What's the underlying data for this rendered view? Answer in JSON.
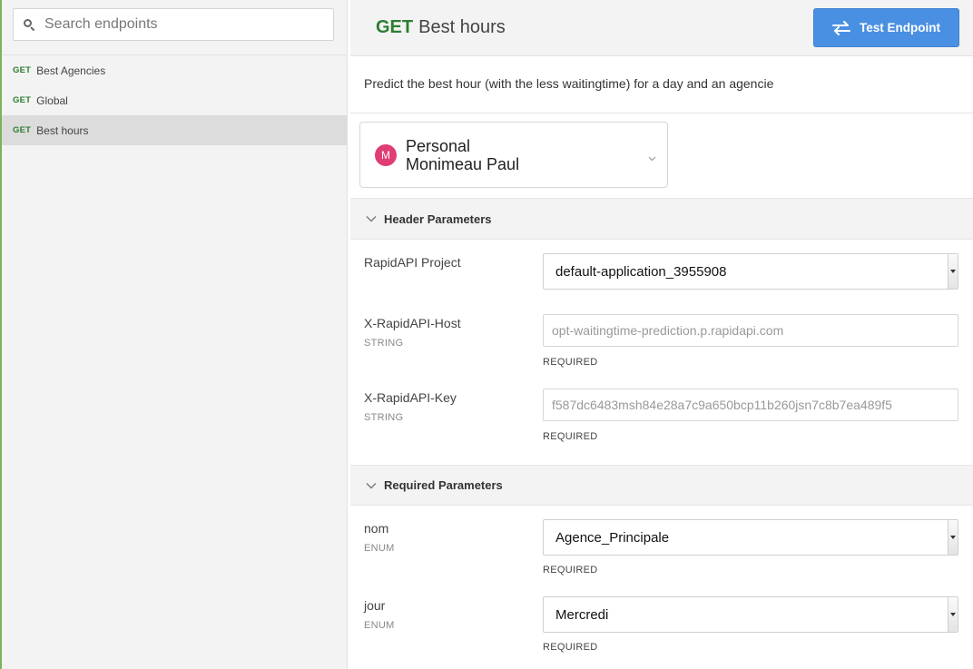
{
  "sidebar": {
    "search_placeholder": "Search endpoints",
    "endpoints": [
      {
        "method": "GET",
        "label": "Best Agencies"
      },
      {
        "method": "GET",
        "label": "Global"
      },
      {
        "method": "GET",
        "label": "Best hours"
      }
    ]
  },
  "header": {
    "method": "GET",
    "title": "Best hours",
    "test_button": "Test Endpoint"
  },
  "description": "Predict the best hour (with the less waitingtime) for a day and an agencie",
  "account": {
    "avatar_letter": "M",
    "line1": "Personal",
    "line2": "Monimeau Paul"
  },
  "header_params": {
    "title": "Header Parameters",
    "project_label": "RapidAPI Project",
    "project_value": "default-application_3955908",
    "host_label": "X-RapidAPI-Host",
    "host_type": "STRING",
    "host_value": "opt-waitingtime-prediction.p.rapidapi.com",
    "host_required": "REQUIRED",
    "key_label": "X-RapidAPI-Key",
    "key_type": "STRING",
    "key_value": "f587dc6483msh84e28a7c9a650bcp11b260jsn7c8b7ea489f5",
    "key_required": "REQUIRED"
  },
  "required_params": {
    "title": "Required Parameters",
    "nom_label": "nom",
    "nom_type": "ENUM",
    "nom_value": "Agence_Principale",
    "nom_required": "REQUIRED",
    "jour_label": "jour",
    "jour_type": "ENUM",
    "jour_value": "Mercredi",
    "jour_required": "REQUIRED"
  },
  "colors": {
    "method_green": "#2e7d32",
    "button_blue": "#4a90e2",
    "avatar_pink": "#e03c75"
  }
}
